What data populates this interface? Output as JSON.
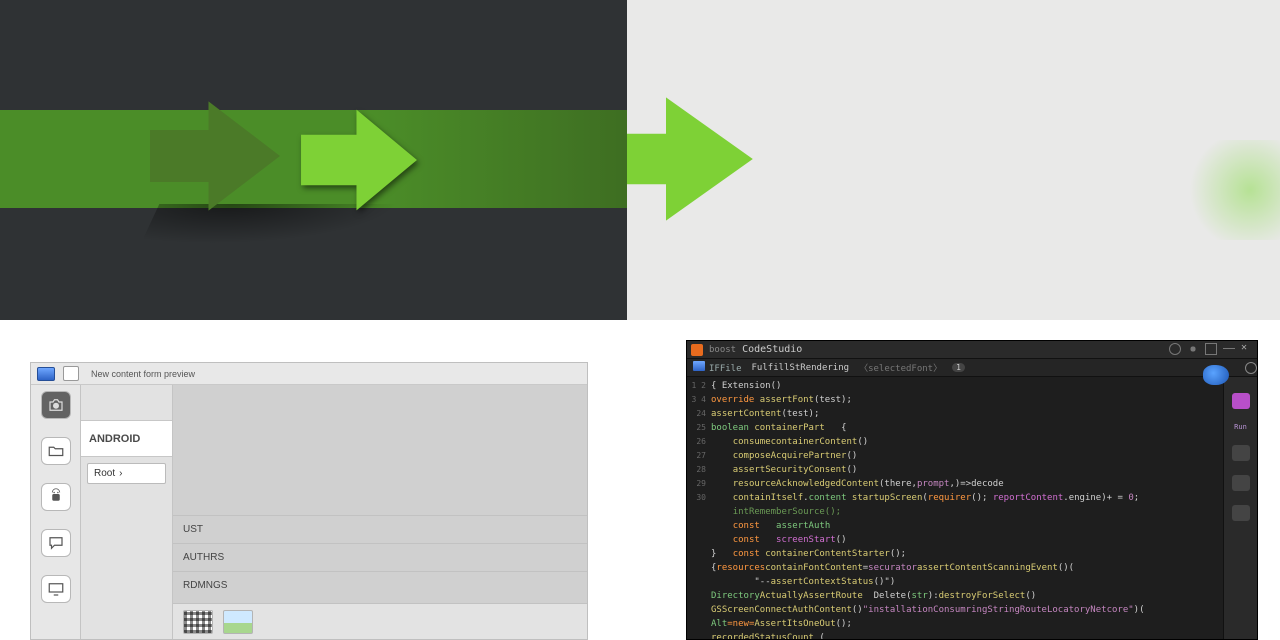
{
  "hero": {
    "shape": "right-arrow",
    "accent_color": "#7ed136",
    "band_color": "#4b8d28"
  },
  "builder": {
    "title_text": "New content form preview",
    "rail_icons": [
      "camera-icon",
      "folder-icon",
      "android-icon",
      "chat-icon",
      "monitor-icon"
    ],
    "tabs": {
      "blank": "",
      "android": "ANDROID",
      "root_label": "Root",
      "root_chevron": "›"
    },
    "side_list": [
      "UST",
      "AUTHRS",
      "RDMNGS"
    ],
    "thumbs": [
      "grid",
      "picture"
    ]
  },
  "ide": {
    "app_title_prefix": "boost",
    "app_title": "CodeStudio",
    "open_tab": "IFFile",
    "module": "FulfillStRendering",
    "module_hint": "selectedFont",
    "badge": "1",
    "right_label": "Run",
    "gutter": [
      "1",
      "2",
      "3",
      "4",
      "24",
      "25",
      "26",
      "27",
      "28",
      "29",
      "30",
      "",
      "",
      "",
      "",
      "",
      "",
      "",
      ""
    ],
    "lines": [
      {
        "indent": 0,
        "tokens": [
          [
            "pl",
            "{ Extension() "
          ]
        ]
      },
      {
        "indent": 0,
        "tokens": [
          [
            "kw",
            "override "
          ],
          [
            "fn",
            "assertFont"
          ],
          [
            "pl",
            "(test);"
          ]
        ]
      },
      {
        "indent": 0,
        "tokens": [
          [
            "fn",
            "assertContent"
          ],
          [
            "pl",
            "(test);"
          ]
        ]
      },
      {
        "indent": 0,
        "tokens": [
          [
            "ty",
            "boolean "
          ],
          [
            "fn",
            "containerPart"
          ],
          [
            "pl",
            "   {"
          ]
        ]
      },
      {
        "indent": 1,
        "tokens": [
          [
            "fn",
            "consumecontainerContent"
          ],
          [
            "pl",
            "()"
          ]
        ]
      },
      {
        "indent": 1,
        "tokens": [
          [
            "fn",
            "composeAcquirePartner"
          ],
          [
            "pl",
            "()"
          ]
        ]
      },
      {
        "indent": 1,
        "tokens": [
          [
            "fn",
            "assertSecurityConsent"
          ],
          [
            "pl",
            "()"
          ]
        ]
      },
      {
        "indent": 1,
        "tokens": [
          [
            "fn",
            "resourceAcknowledgedContent"
          ],
          [
            "pl",
            "(there,"
          ],
          [
            "str",
            "prompt"
          ],
          [
            "pl",
            ",)=>decode"
          ]
        ]
      },
      {
        "indent": 1,
        "tokens": [
          [
            "fn",
            "containItself"
          ],
          [
            "pl",
            "."
          ],
          [
            "ty",
            "content "
          ],
          [
            "fn",
            "startupScreen"
          ],
          [
            "pl",
            "("
          ],
          [
            "kw",
            "requirer"
          ],
          [
            "pl",
            "(); "
          ],
          [
            "mg",
            "reportContent"
          ],
          [
            "pl",
            ".engine)+ = "
          ],
          [
            "str",
            "0"
          ],
          [
            "pl",
            ";"
          ]
        ]
      },
      {
        "indent": 1,
        "tokens": [
          [
            "cm",
            "intRememberSource();"
          ]
        ]
      },
      {
        "indent": 1,
        "tokens": [
          [
            "kw",
            "const   "
          ],
          [
            "ty",
            "assertAuth"
          ]
        ]
      },
      {
        "indent": 1,
        "tokens": [
          [
            "kw",
            "const   "
          ],
          [
            "mg",
            "screenStart"
          ],
          [
            "pl",
            "()"
          ]
        ]
      },
      {
        "indent": 0,
        "tokens": [
          [
            "pl",
            "}   "
          ],
          [
            "kw",
            "const "
          ],
          [
            "fn",
            "containerContentStarter"
          ],
          [
            "pl",
            "();"
          ]
        ]
      },
      {
        "indent": 0,
        "tokens": [
          [
            "pl",
            "{"
          ],
          [
            "kw",
            "resources"
          ],
          [
            "fn",
            "containFontContent"
          ],
          [
            "pl",
            "="
          ],
          [
            "str",
            "securator"
          ],
          [
            "fn",
            "assertContentScanningEvent"
          ],
          [
            "pl",
            "()("
          ]
        ]
      },
      {
        "indent": 2,
        "tokens": [
          [
            "pl",
            "\"--"
          ],
          [
            "fn",
            "assertContextStatus"
          ],
          [
            "pl",
            "()\")"
          ]
        ]
      },
      {
        "indent": 0,
        "tokens": [
          [
            "ty",
            "Directory"
          ],
          [
            "fn",
            "ActuallyAssertRoute "
          ],
          [
            "pl",
            " Delete("
          ],
          [
            "ty",
            "str"
          ],
          [
            "pl",
            "):"
          ],
          [
            "fn",
            "destroyForSelect"
          ],
          [
            "pl",
            "()"
          ]
        ]
      },
      {
        "indent": 0,
        "tokens": [
          [
            "fn",
            "GSScreenConnectAuthContent"
          ],
          [
            "pl",
            "()"
          ],
          [
            "str",
            "\"installationConsumringStringRouteLocatoryNetcore\""
          ],
          [
            "pl",
            ")("
          ]
        ]
      },
      {
        "indent": 0,
        "tokens": [
          [
            "ty",
            "Alt"
          ],
          [
            "kw",
            "=new="
          ],
          [
            "fn",
            "AssertItsOneOut"
          ],
          [
            "pl",
            "();"
          ]
        ]
      },
      {
        "indent": 0,
        "tokens": [
          [
            "fn",
            "recordedStatusCount"
          ],
          [
            "pl",
            " ("
          ]
        ]
      }
    ]
  }
}
